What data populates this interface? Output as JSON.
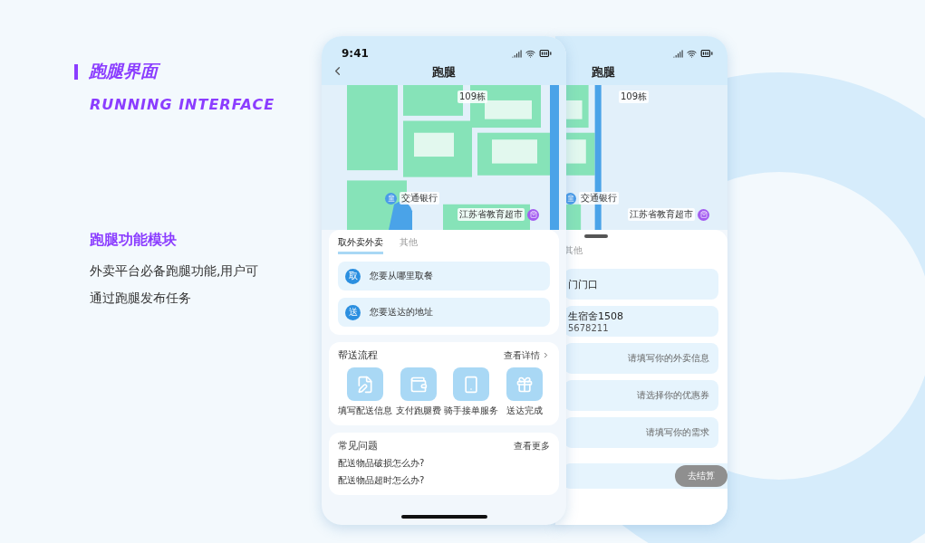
{
  "heading": {
    "title": "跑腿界面",
    "subtitle": "RUNNING INTERFACE"
  },
  "feature": {
    "title": "跑腿功能模块",
    "lines": [
      "外卖平台必备跑腿功能,用户可",
      "通过跑腿发布任务"
    ]
  },
  "front_phone": {
    "time": "9:41",
    "title": "跑腿",
    "map_labels": [
      {
        "kind": "plain",
        "text": "109栋"
      },
      {
        "kind": "bank",
        "text": "交通银行"
      },
      {
        "kind": "shop",
        "text": "江苏省教育超市"
      }
    ],
    "tabs": [
      {
        "label": "取外卖外卖",
        "selected": true
      },
      {
        "label": "其他",
        "selected": false
      }
    ],
    "address_rows": [
      {
        "badge": "取",
        "text": "您要从哪里取餐"
      },
      {
        "badge": "送",
        "text": "您要送达的地址"
      }
    ],
    "process": {
      "title": "帮送流程",
      "link": "查看详情",
      "steps": [
        {
          "kind": "form",
          "label": "填写配送信息"
        },
        {
          "kind": "wallet",
          "label": "支付跑腿费"
        },
        {
          "kind": "phone",
          "label": "骑手接单服务"
        },
        {
          "kind": "gift",
          "label": "送达完成"
        }
      ]
    },
    "faq": {
      "title": "常见问题",
      "link": "查看更多",
      "questions": [
        "配送物品破损怎么办?",
        "配送物品超时怎么办?"
      ]
    }
  },
  "back_phone": {
    "title": "跑腿",
    "map_labels": [
      {
        "kind": "plain",
        "text": "109栋"
      },
      {
        "kind": "bank",
        "text": "交通银行"
      },
      {
        "kind": "shop",
        "text": "江苏省教育超市"
      }
    ],
    "tabs": [
      {
        "label": "其他",
        "selected": false
      }
    ],
    "rows": [
      {
        "kind": "value",
        "text": "门门口"
      },
      {
        "kind": "contact",
        "text": "生宿舍1508",
        "sub": "5678211"
      },
      {
        "kind": "placeholder",
        "text": "请填写你的外卖信息"
      },
      {
        "kind": "placeholder",
        "text": "请选择你的优惠券"
      },
      {
        "kind": "placeholder",
        "text": "请填写你的需求"
      }
    ],
    "checkout": {
      "label": "去结算",
      "disabled": true
    }
  }
}
